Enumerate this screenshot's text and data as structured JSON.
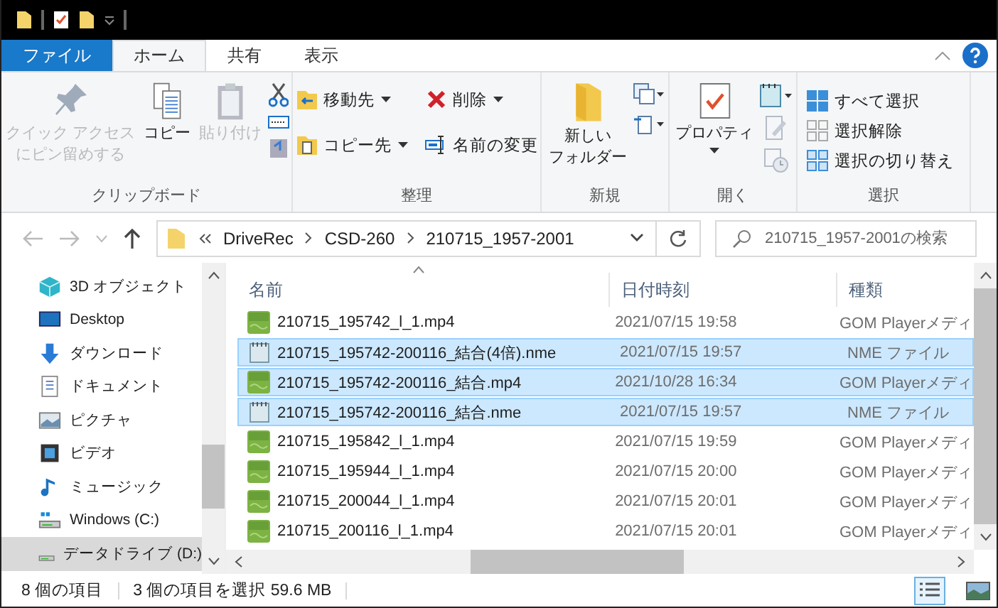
{
  "ribbon_tabs": [
    {
      "label": "ファイル",
      "kind": "file",
      "selected": false
    },
    {
      "label": "ホーム",
      "kind": "tab",
      "selected": true
    },
    {
      "label": "共有",
      "kind": "tab",
      "selected": false
    },
    {
      "label": "表示",
      "kind": "tab",
      "selected": false
    }
  ],
  "ribbon_groups": [
    {
      "label": "クリップボード",
      "items": [
        {
          "lines": [
            "クイック アクセス",
            "にピン留めする"
          ],
          "kind": "large",
          "disabled": true
        },
        {
          "lines": [
            "コピー"
          ],
          "kind": "large",
          "disabled": false
        },
        {
          "lines": [
            "貼り付け"
          ],
          "kind": "large",
          "disabled": true
        },
        {
          "kind": "iconstack"
        }
      ]
    },
    {
      "label": "整理",
      "items": [
        {
          "label": "移動先",
          "kind": "small",
          "dropdown": true,
          "disabled": false
        },
        {
          "label": "コピー先",
          "kind": "small",
          "dropdown": true,
          "disabled": false
        },
        {
          "label": "削除",
          "kind": "small",
          "dropdown": true,
          "disabled": false
        },
        {
          "label": "名前の変更",
          "kind": "small",
          "disabled": false
        }
      ]
    },
    {
      "label": "新規",
      "items": [
        {
          "lines": [
            "新しい",
            "フォルダー"
          ],
          "kind": "large",
          "disabled": false
        },
        {
          "kind": "iconstack"
        }
      ]
    },
    {
      "label": "開く",
      "items": [
        {
          "lines": [
            "プロパティ"
          ],
          "kind": "large",
          "dropdown": true,
          "disabled": false
        },
        {
          "kind": "iconstack"
        }
      ]
    },
    {
      "label": "選択",
      "items": [
        {
          "label": "すべて選択",
          "kind": "small",
          "disabled": false
        },
        {
          "label": "選択解除",
          "kind": "small",
          "disabled": false
        },
        {
          "label": "選択の切り替え",
          "kind": "small",
          "disabled": false
        }
      ]
    }
  ],
  "address": {
    "breadcrumb": [
      "DriveRec",
      "CSD-260",
      "210715_1957-2001"
    ]
  },
  "search": {
    "placeholder": "210715_1957-2001の検索"
  },
  "nav_items": [
    {
      "label": "3D オブジェクト",
      "selected": false
    },
    {
      "label": "Desktop",
      "selected": false
    },
    {
      "label": "ダウンロード",
      "selected": false
    },
    {
      "label": "ドキュメント",
      "selected": false
    },
    {
      "label": "ピクチャ",
      "selected": false
    },
    {
      "label": "ビデオ",
      "selected": false
    },
    {
      "label": "ミュージック",
      "selected": false
    },
    {
      "label": "Windows (C:)",
      "selected": false
    },
    {
      "label": "データドライブ (D:)",
      "selected": true
    }
  ],
  "columns": [
    "名前",
    "日付時刻",
    "種類"
  ],
  "rows": [
    {
      "name": "210715_195742_l_1.mp4",
      "date": "2021/07/15 19:58",
      "type": "GOM Playerメディ",
      "kind": "mp4",
      "selected": false
    },
    {
      "name": "210715_195742-200116_結合(4倍).nme",
      "date": "2021/07/15 19:57",
      "type": "NME ファイル",
      "kind": "nme",
      "selected": true
    },
    {
      "name": "210715_195742-200116_結合.mp4",
      "date": "2021/10/28 16:34",
      "type": "GOM Playerメディ",
      "kind": "mp4",
      "selected": true
    },
    {
      "name": "210715_195742-200116_結合.nme",
      "date": "2021/07/15 19:57",
      "type": "NME ファイル",
      "kind": "nme",
      "selected": true
    },
    {
      "name": "210715_195842_l_1.mp4",
      "date": "2021/07/15 19:59",
      "type": "GOM Playerメディ",
      "kind": "mp4",
      "selected": false
    },
    {
      "name": "210715_195944_l_1.mp4",
      "date": "2021/07/15 20:00",
      "type": "GOM Playerメディ",
      "kind": "mp4",
      "selected": false
    },
    {
      "name": "210715_200044_l_1.mp4",
      "date": "2021/07/15 20:01",
      "type": "GOM Playerメディ",
      "kind": "mp4",
      "selected": false
    },
    {
      "name": "210715_200116_l_1.mp4",
      "date": "2021/07/15 20:01",
      "type": "GOM Playerメディ",
      "kind": "mp4",
      "selected": false
    }
  ],
  "status": {
    "count": "8 個の項目",
    "selection": "3 個の項目を選択  59.6 MB"
  },
  "view_buttons": [
    {
      "kind": "details",
      "selected": true
    },
    {
      "kind": "large",
      "selected": false
    }
  ]
}
